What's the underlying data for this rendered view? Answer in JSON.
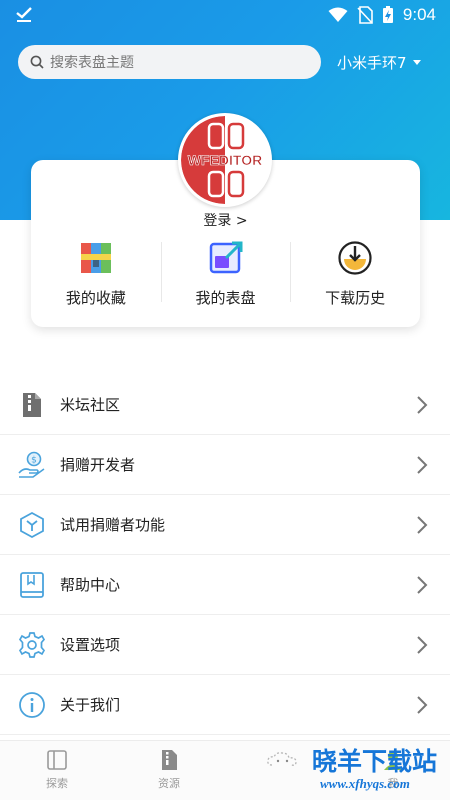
{
  "status_bar": {
    "time": "9:04"
  },
  "search": {
    "placeholder": "搜索表盘主题"
  },
  "device_selector": {
    "label": "小米手环7"
  },
  "profile": {
    "logo_text": "WFEDITOR",
    "login_label": "登录 >"
  },
  "quick_actions": [
    {
      "label": "我的收藏",
      "icon": "favorites-icon"
    },
    {
      "label": "我的表盘",
      "icon": "watchface-icon"
    },
    {
      "label": "下载历史",
      "icon": "download-history-icon"
    }
  ],
  "menu": [
    {
      "label": "米坛社区",
      "icon": "community-icon"
    },
    {
      "label": "捐赠开发者",
      "icon": "donate-icon"
    },
    {
      "label": "试用捐赠者功能",
      "icon": "trial-icon"
    },
    {
      "label": "帮助中心",
      "icon": "help-book-icon"
    },
    {
      "label": "设置选项",
      "icon": "settings-gear-icon"
    },
    {
      "label": "关于我们",
      "icon": "info-icon"
    }
  ],
  "tab_bar": [
    {
      "label": "探索",
      "icon": "explore-icon"
    },
    {
      "label": "资源",
      "icon": "resource-icon"
    },
    {
      "label": "",
      "icon": "cloud-icon"
    },
    {
      "label": "我",
      "icon": "me-icon"
    }
  ],
  "watermark": {
    "title": "晓羊下载站",
    "url": "www.xfhyqs.com"
  },
  "colors": {
    "accent": "#1a8fe3",
    "hero_end": "#17b6df",
    "watermark": "#1676d8"
  }
}
